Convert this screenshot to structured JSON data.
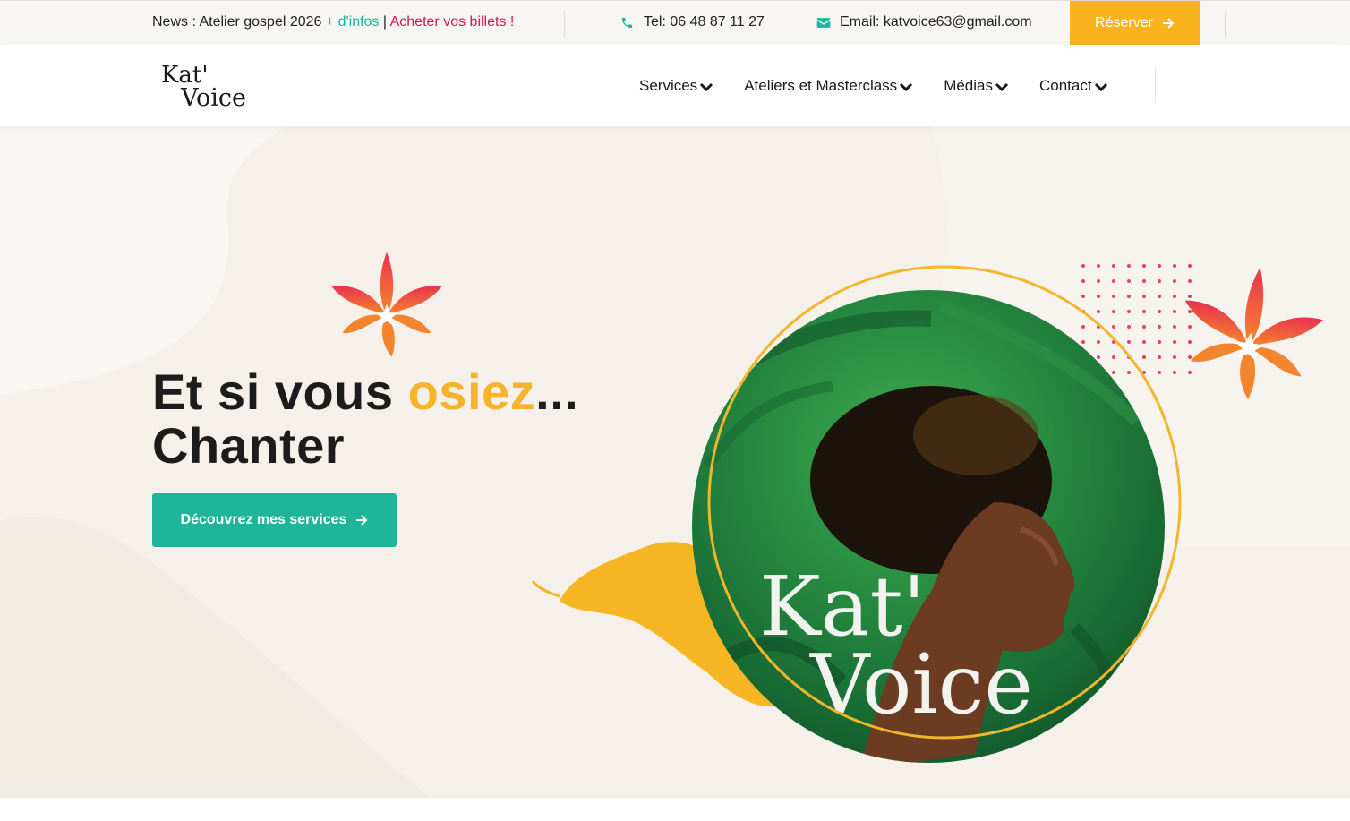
{
  "topbar": {
    "news_prefix": "News : Atelier gospel 2026 ",
    "news_more": "+ d'infos",
    "news_sep": " | ",
    "news_tickets": "Acheter vos billets !",
    "phone": "Tel: 06 48 87 11 27",
    "email": "Email: katvoice63@gmail.com",
    "reserve_label": "Réserver"
  },
  "header": {
    "logo_line1": "Kat'",
    "logo_line2": "Voice",
    "nav": [
      {
        "label": "Services"
      },
      {
        "label": "Ateliers et Masterclass"
      },
      {
        "label": "Médias"
      },
      {
        "label": "Contact"
      }
    ]
  },
  "hero": {
    "headline_start": "Et si vous ",
    "headline_accent": "osiez",
    "headline_ellipsis": "...",
    "headline_line2": "Chanter",
    "cta_label": "Découvrez mes services",
    "portrait_logo_line1": "Kat'",
    "portrait_logo_line2": "Voice"
  },
  "colors": {
    "accent_yellow": "#f9b31d",
    "accent_teal": "#1fb59b",
    "accent_red": "#d8164d",
    "hero_bg": "#f5f0e9"
  },
  "icons": [
    "phone-icon",
    "mail-icon",
    "arrow-right-icon",
    "chevron-down-icon",
    "flower-icon"
  ]
}
